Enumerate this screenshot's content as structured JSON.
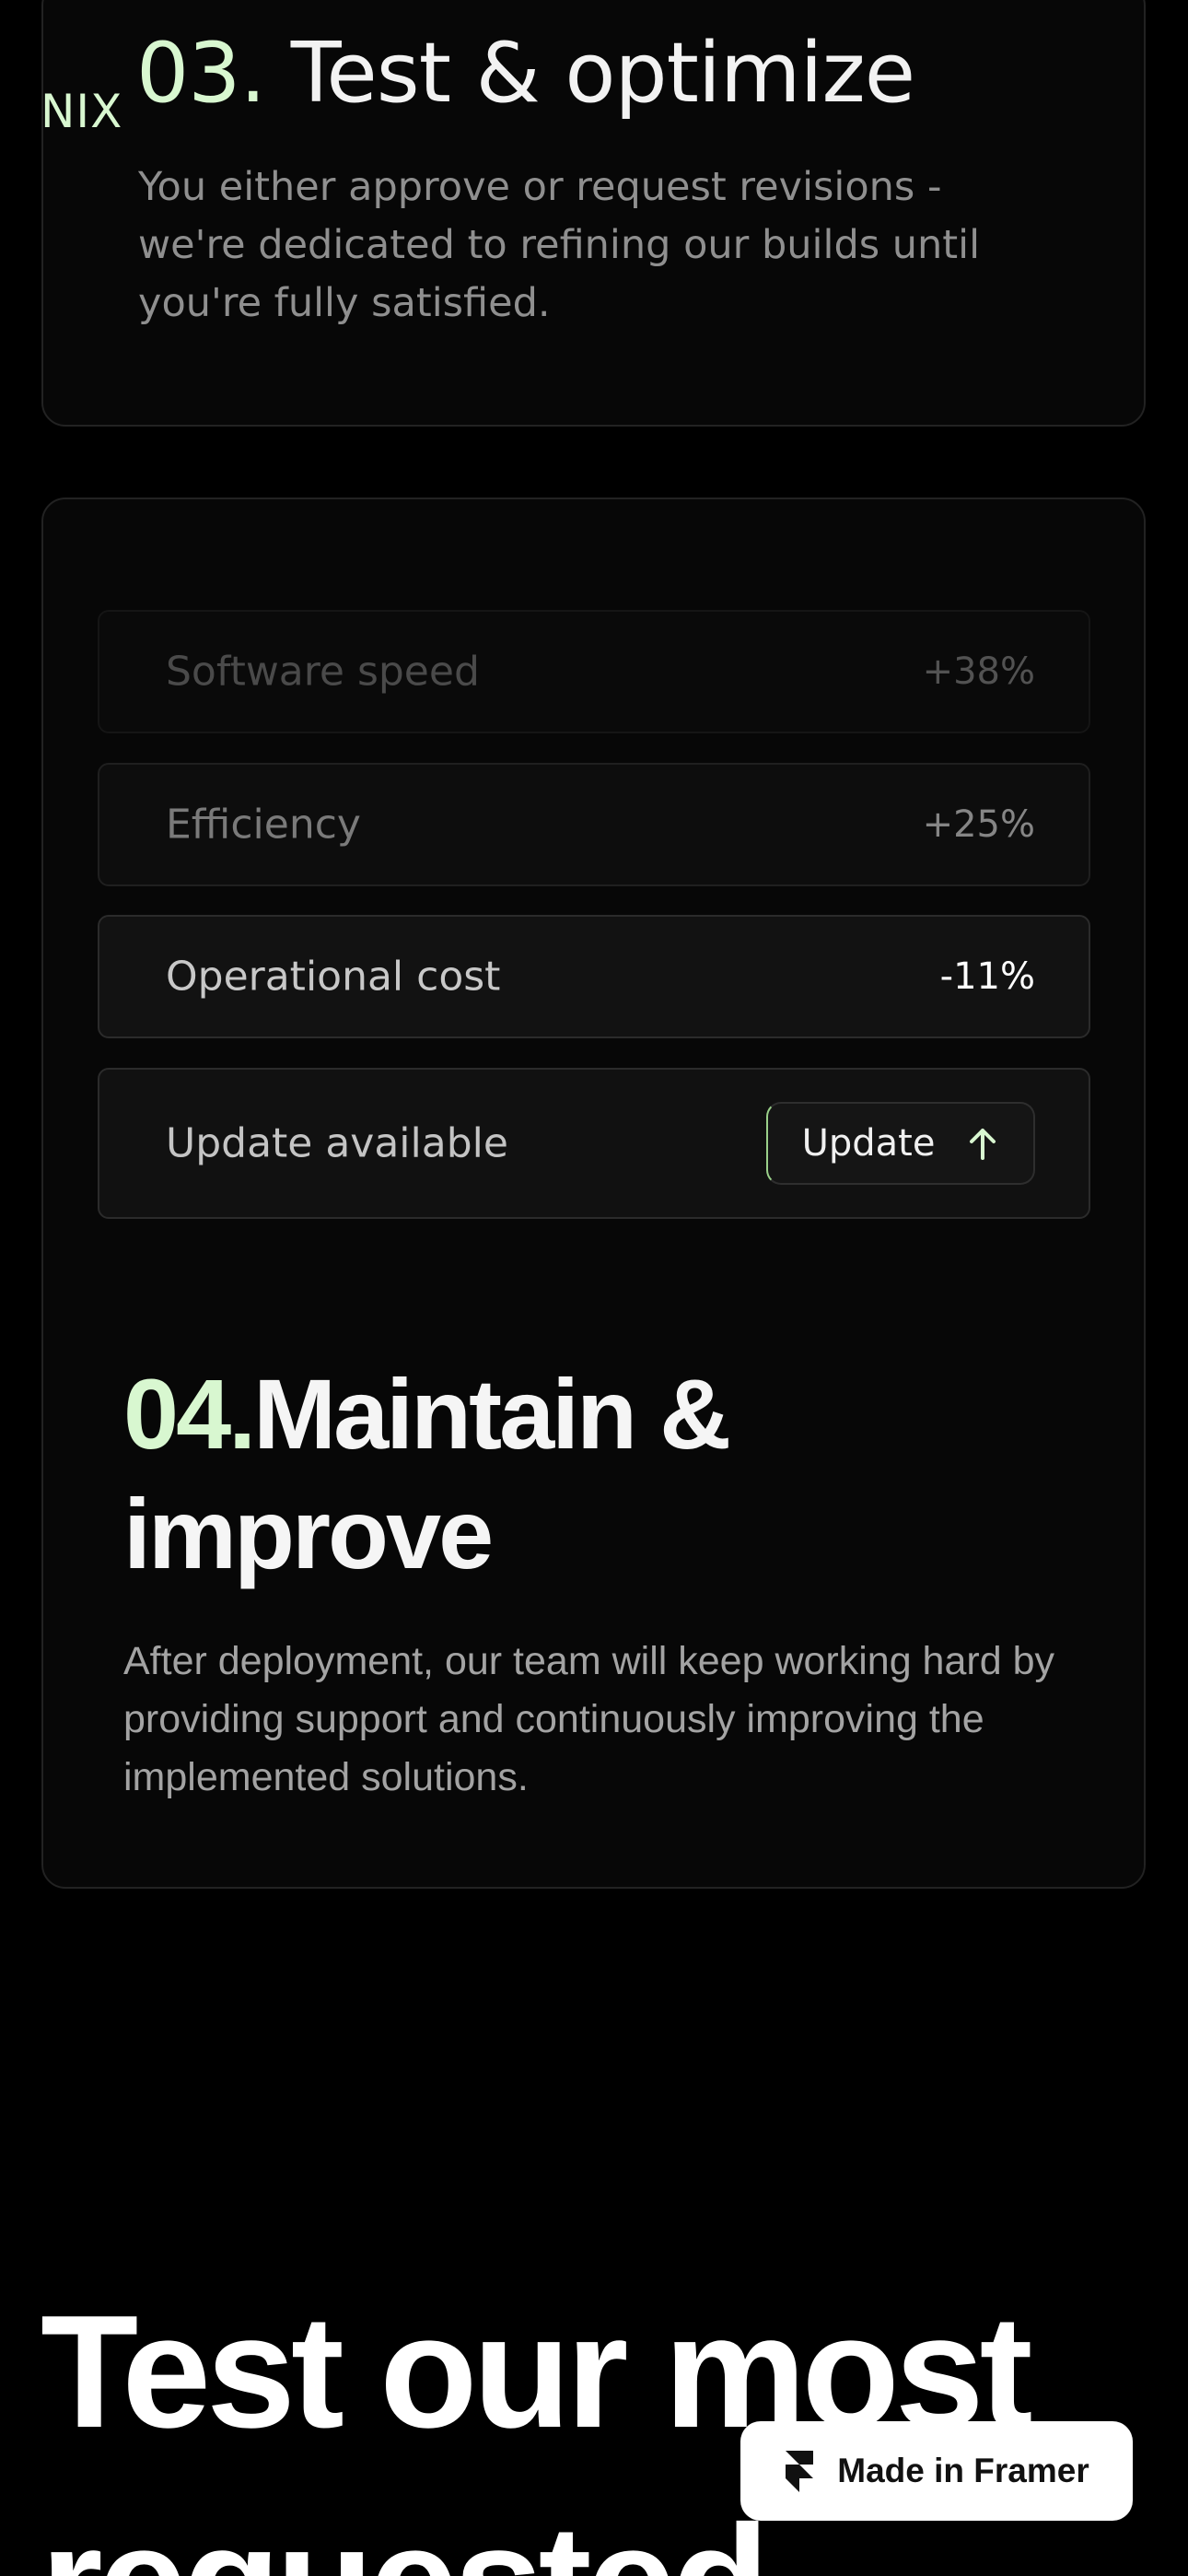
{
  "brand": {
    "logo_text": "NIX",
    "accent_color": "#d8f7d0"
  },
  "step3": {
    "number": "03.",
    "title": "Test & optimize",
    "description": "You either approve or request revisions - we're dedicated to refining our builds until you're fully satisfied."
  },
  "metrics": [
    {
      "label": "Software speed",
      "value": "+38%"
    },
    {
      "label": "Efficiency",
      "value": "+25%"
    },
    {
      "label": "Operational cost",
      "value": "-11%"
    }
  ],
  "update": {
    "label": "Update available",
    "button_label": "Update",
    "button_icon": "arrow-up-icon"
  },
  "step4": {
    "number": "04.",
    "title": "Maintain & improve",
    "description": "After deployment, our team will keep working hard by providing support and continuously improving the implemented solutions."
  },
  "section": {
    "heading": "Test our most requested"
  },
  "badge": {
    "label": "Made in Framer",
    "icon": "framer-logo-icon"
  }
}
